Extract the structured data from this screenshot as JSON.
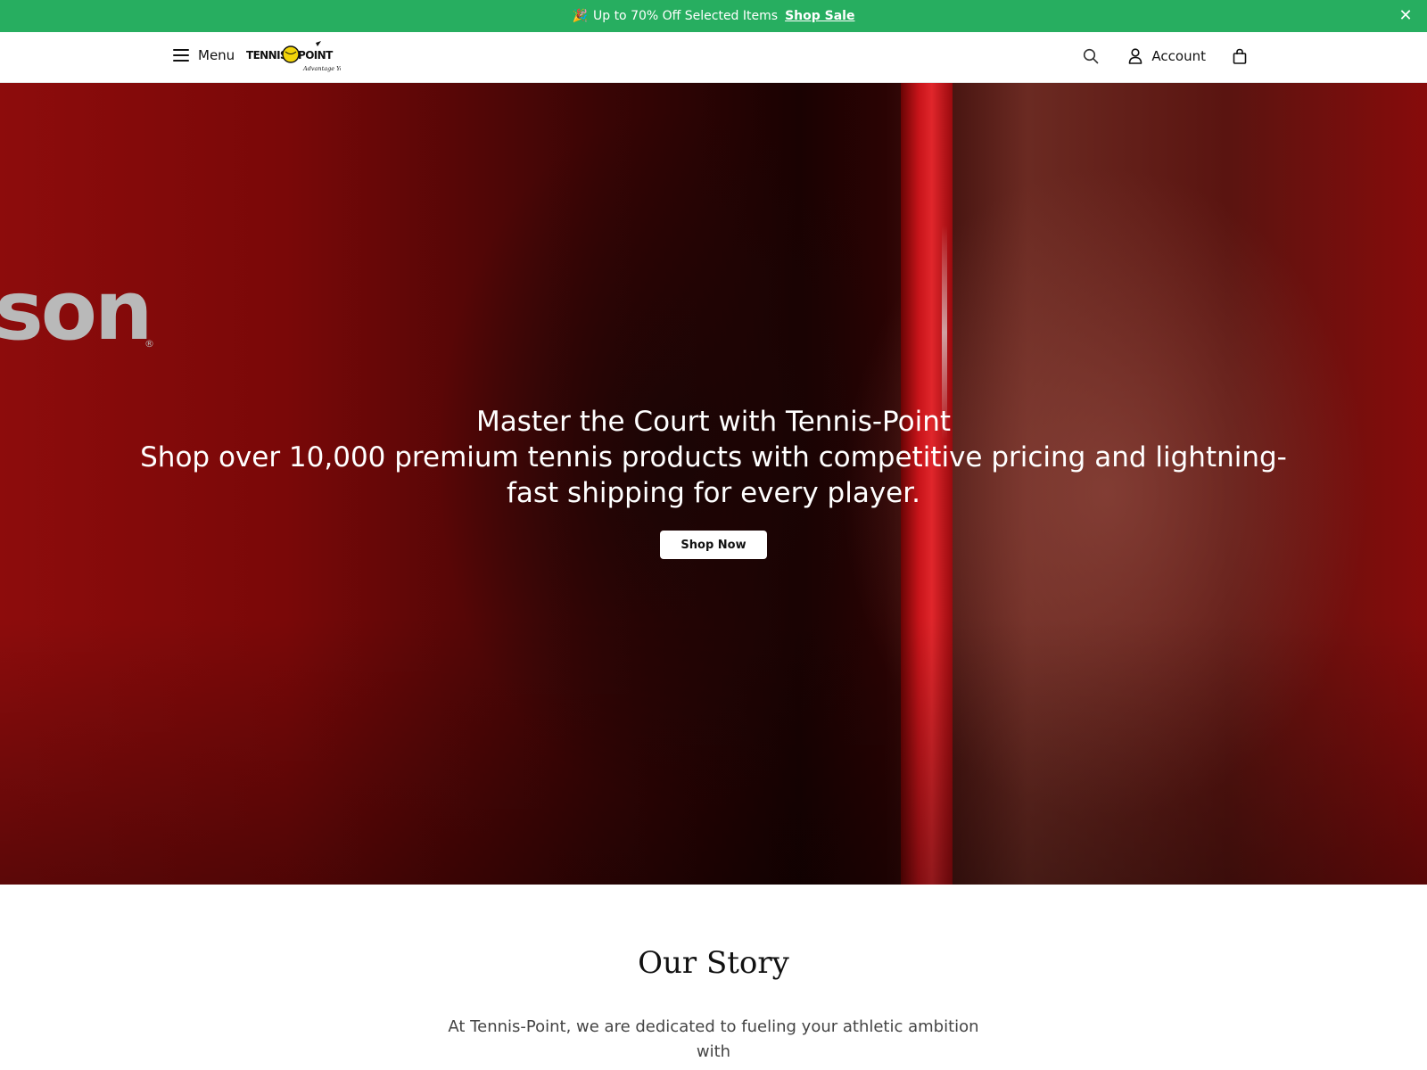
{
  "announcement": {
    "emoji": "🎉",
    "text": "Up to 70% Off Selected Items",
    "link_label": "Shop Sale",
    "close_glyph": "✕"
  },
  "header": {
    "menu_label": "Menu",
    "logo_alt": "Tennis Point",
    "account_label": "Account",
    "icons": [
      "hamburger-icon",
      "search-icon",
      "user-icon",
      "shopping-bag-icon"
    ]
  },
  "hero": {
    "title": "Master the Court with Tennis-Point",
    "subtitle": "Shop over 10,000 premium tennis products with competitive pricing and lightning-fast shipping for every player.",
    "cta_label": "Shop Now",
    "background_brand_text": "son",
    "brand_reg": "®"
  },
  "story": {
    "heading": "Our Story",
    "body": "At Tennis-Point, we are dedicated to fueling your athletic ambition with"
  },
  "colors": {
    "announcement_bg": "#27ae60",
    "hero_red": "#8d0c0c",
    "text_dark": "#111111"
  }
}
